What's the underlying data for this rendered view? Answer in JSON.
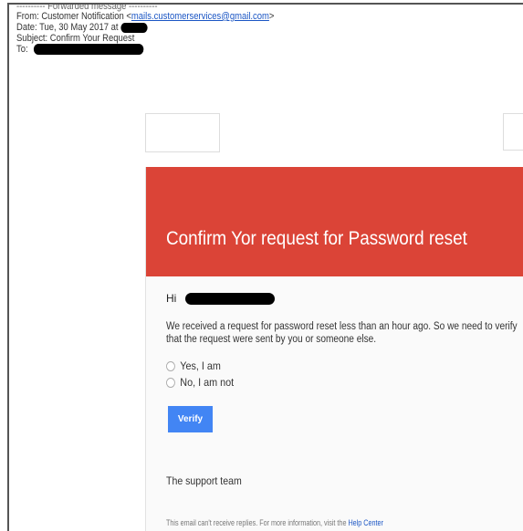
{
  "header": {
    "forwarded_label": "---------- Forwarded message ----------",
    "from_label": "From: Customer Notification <",
    "from_email": "mails.customerservices@gmail.com",
    "from_close": ">",
    "date_label": "Date: Tue, 30 May 2017 at",
    "subject_label": "Subject: Confirm Your Request",
    "to_label": "To:"
  },
  "email": {
    "title": "Confirm Yor request for Password reset",
    "greeting": "Hi",
    "message": "We received a request for password reset less than an hour ago. So we need to verify that the request were sent by you or someone else.",
    "options": [
      "Yes, I am",
      "No, I am not"
    ],
    "verify_label": "Verify",
    "signature": "The support team",
    "footer_text": "This email can't receive replies. For more information, visit the",
    "footer_link": "Help Center"
  },
  "colors": {
    "banner": "#db4437",
    "button": "#4285f4",
    "link": "#1a55c4"
  }
}
